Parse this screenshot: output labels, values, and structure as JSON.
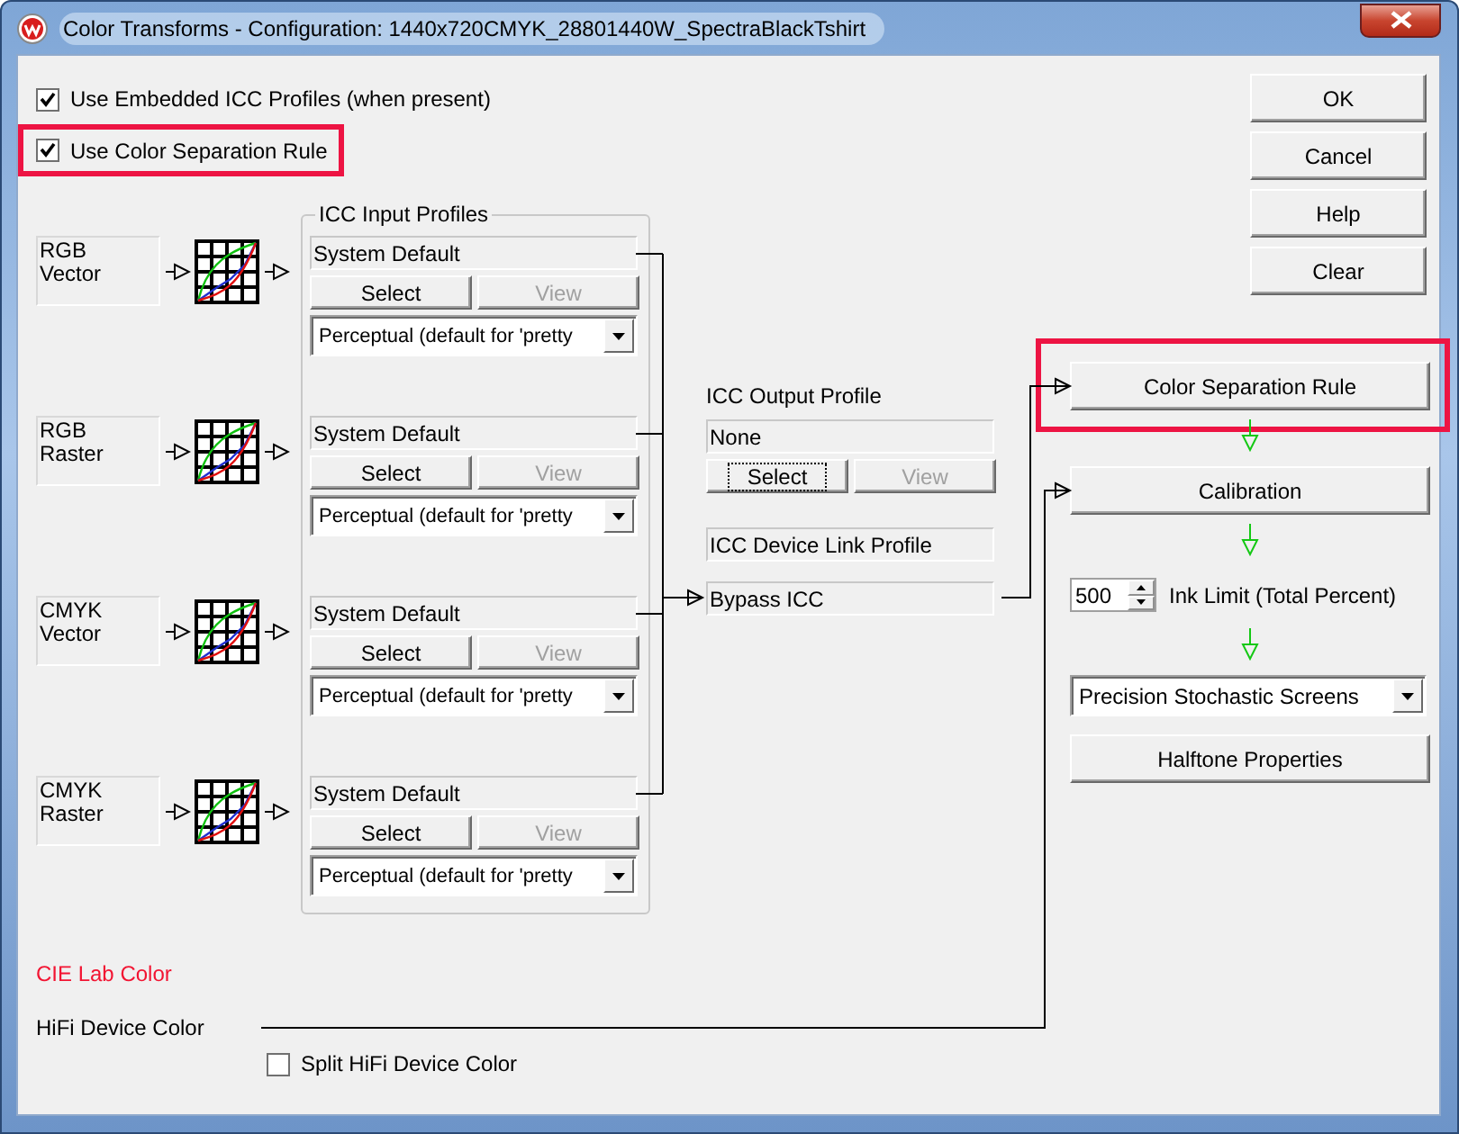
{
  "window": {
    "title": "Color Transforms - Configuration: 1440x720CMYK_28801440W_SpectraBlackTshirt"
  },
  "options": [
    {
      "label": "Use Embedded ICC Profiles (when present)",
      "checked": true,
      "highlighted": false
    },
    {
      "label": "Use Color Separation Rule",
      "checked": true,
      "highlighted": true
    }
  ],
  "dialog_buttons": [
    "OK",
    "Cancel",
    "Help",
    "Clear"
  ],
  "input_profiles": {
    "title": "ICC Input Profiles",
    "rows": [
      {
        "source": "RGB Vector",
        "profile": "System Default",
        "select": "Select",
        "view": "View",
        "view_disabled": true,
        "intent": "Perceptual (default for 'pretty"
      },
      {
        "source": "RGB Raster",
        "profile": "System Default",
        "select": "Select",
        "view": "View",
        "view_disabled": true,
        "intent": "Perceptual (default for 'pretty"
      },
      {
        "source": "CMYK Vector",
        "profile": "System Default",
        "select": "Select",
        "view": "View",
        "view_disabled": true,
        "intent": "Perceptual (default for 'pretty"
      },
      {
        "source": "CMYK Raster",
        "profile": "System Default",
        "select": "Select",
        "view": "View",
        "view_disabled": true,
        "intent": "Perceptual (default for 'pretty"
      }
    ]
  },
  "output_profile": {
    "title": "ICC Output Profile",
    "profile": "None",
    "select": "Select",
    "select_focused": true,
    "view": "View",
    "view_disabled": true
  },
  "device_link": {
    "title": "ICC Device Link Profile",
    "value": "Bypass ICC"
  },
  "pipeline": {
    "separation": {
      "label": "Color Separation Rule",
      "highlighted": true
    },
    "calibration": "Calibration",
    "ink_limit": {
      "value": "500",
      "label": "Ink Limit (Total Percent)"
    },
    "screening": "Precision Stochastic Screens",
    "halftone": "Halftone Properties"
  },
  "cie_lab": "CIE Lab Color",
  "hifi": {
    "label": "HiFi Device Color",
    "split": {
      "label": "Split HiFi Device Color",
      "checked": false
    }
  }
}
